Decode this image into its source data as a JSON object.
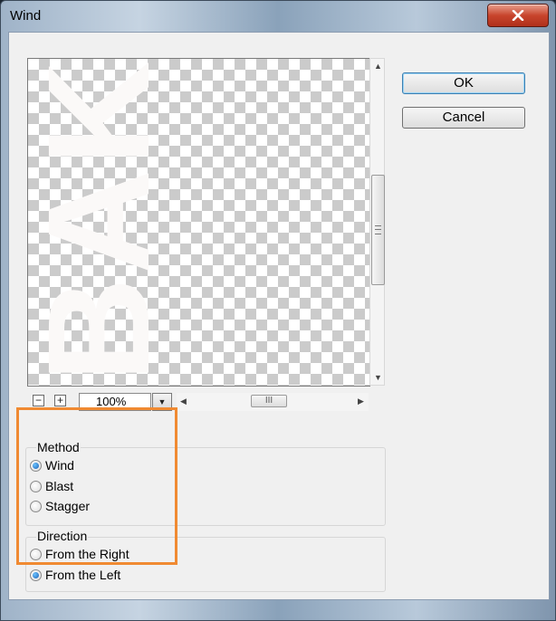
{
  "window": {
    "title": "Wind"
  },
  "preview": {
    "watermark_text": "BAK"
  },
  "zoom": {
    "zoom_out": "−",
    "zoom_in": "+",
    "value": "100%"
  },
  "buttons": {
    "ok": "OK",
    "cancel": "Cancel"
  },
  "method": {
    "legend": "Method",
    "options": [
      {
        "label": "Wind",
        "selected": true
      },
      {
        "label": "Blast",
        "selected": false
      },
      {
        "label": "Stagger",
        "selected": false
      }
    ]
  },
  "direction": {
    "legend": "Direction",
    "options": [
      {
        "label": "From the Right",
        "selected": false
      },
      {
        "label": "From the Left",
        "selected": true
      }
    ]
  },
  "highlight_color": "#f08a32"
}
